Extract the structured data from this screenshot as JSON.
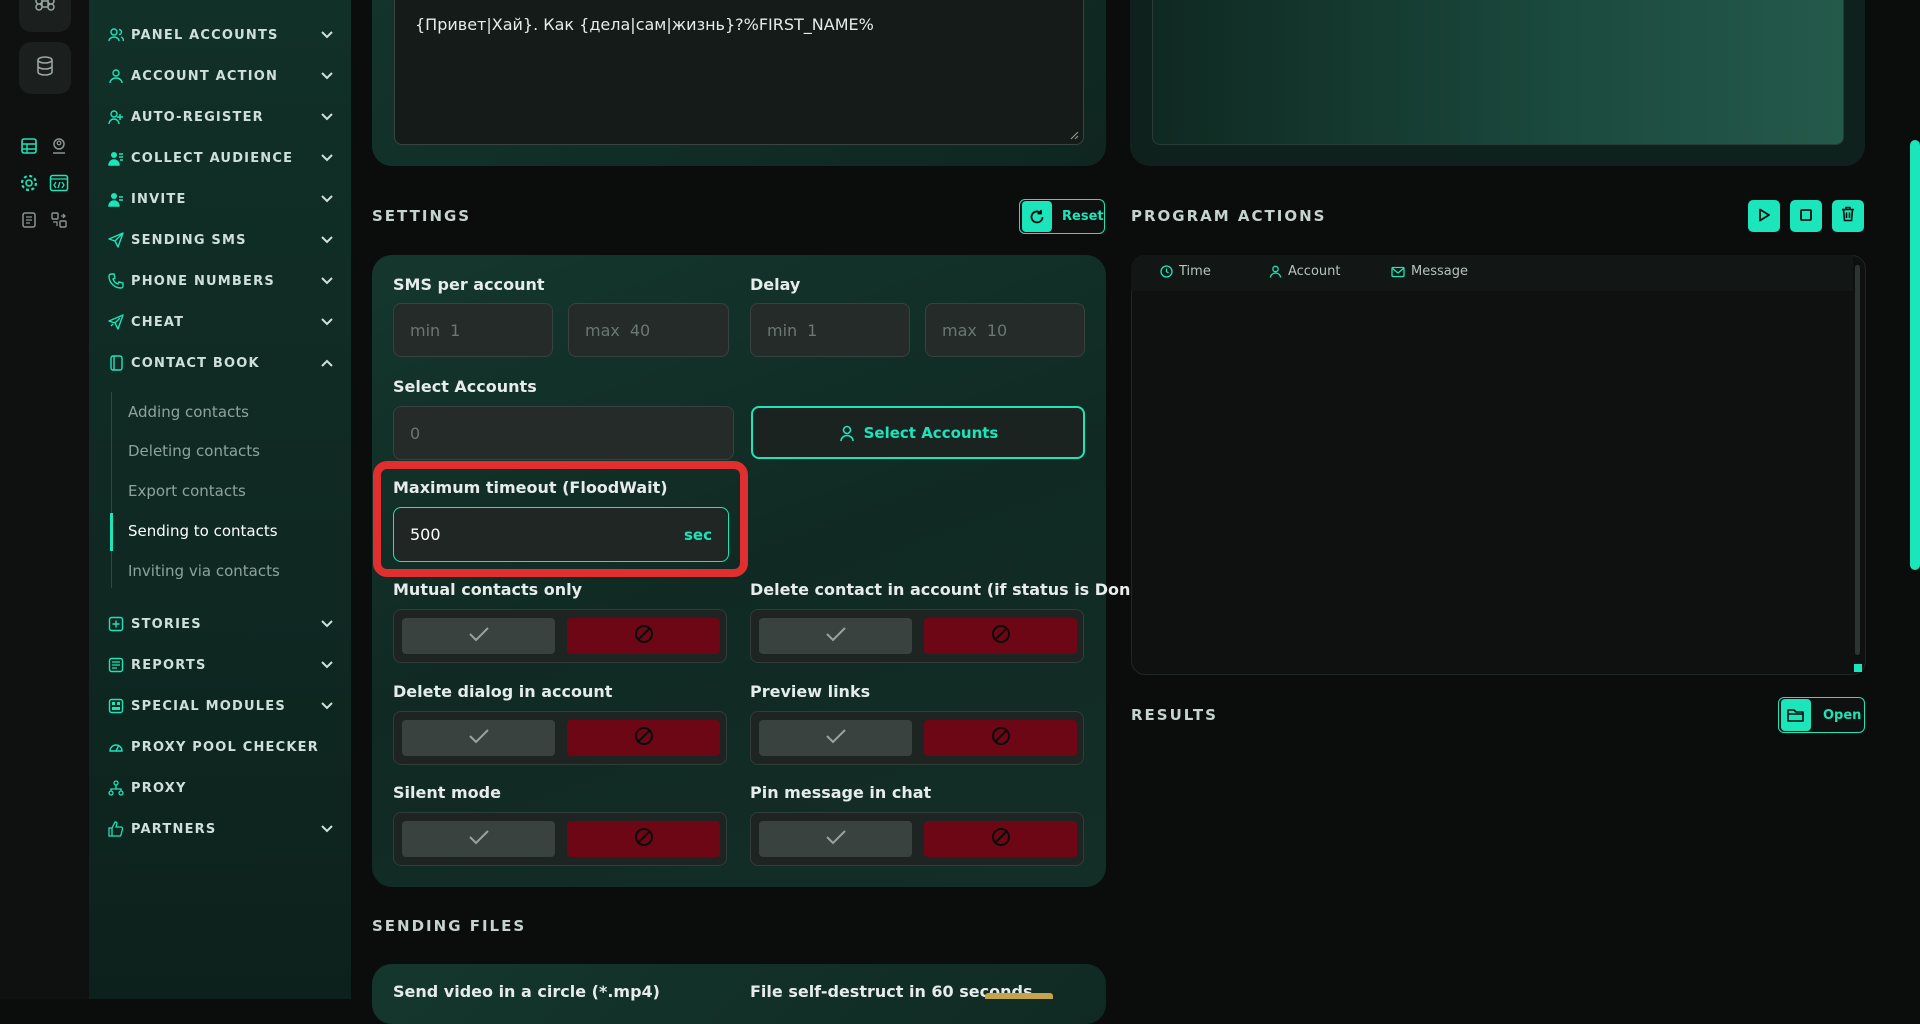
{
  "colors": {
    "accent": "#1be5bb",
    "danger_toggle": "#6d0716",
    "highlight": "#e12f2f",
    "sidebar_bg": "#113027"
  },
  "rail": {
    "icons": [
      "command-icon",
      "database-icon",
      "table-icon",
      "user-pin-icon",
      "settings-icon",
      "code-window-icon",
      "document-icon",
      "grid-icon"
    ]
  },
  "sidebar": {
    "items": [
      {
        "label": "PANEL ACCOUNTS",
        "icon": "users-icon",
        "chevron": "down"
      },
      {
        "label": "ACCOUNT ACTION",
        "icon": "user-icon",
        "chevron": "down"
      },
      {
        "label": "AUTO-REGISTER",
        "icon": "user-plus-icon",
        "chevron": "down"
      },
      {
        "label": "COLLECT AUDIENCE",
        "icon": "user-list-icon",
        "chevron": "down"
      },
      {
        "label": "INVITE",
        "icon": "user-invite-icon",
        "chevron": "down"
      },
      {
        "label": "SENDING SMS",
        "icon": "send-icon",
        "chevron": "down"
      },
      {
        "label": "PHONE NUMBERS",
        "icon": "phone-icon",
        "chevron": "down"
      },
      {
        "label": "CHEAT",
        "icon": "megaphone-icon",
        "chevron": "down"
      },
      {
        "label": "CONTACT BOOK",
        "icon": "book-icon",
        "chevron": "up"
      },
      {
        "label": "STORIES",
        "icon": "plus-square-icon",
        "chevron": "down"
      },
      {
        "label": "REPORTS",
        "icon": "report-icon",
        "chevron": "down"
      },
      {
        "label": "SPECIAL MODULES",
        "icon": "modules-icon",
        "chevron": "down"
      },
      {
        "label": "PROXY POOL CHECKER",
        "icon": "gauge-icon",
        "chevron": ""
      },
      {
        "label": "PROXY",
        "icon": "network-icon",
        "chevron": ""
      },
      {
        "label": "PARTNERS",
        "icon": "handshake-icon",
        "chevron": "down"
      }
    ],
    "contact_book_sub": [
      "Adding contacts",
      "Deleting contacts",
      "Export contacts",
      "Sending to contacts",
      "Inviting via contacts"
    ],
    "active_sub": "Sending to contacts"
  },
  "message": {
    "text": "{Привет|Хай}. Как {дела|сам|жизнь}?%FIRST_NAME%"
  },
  "settings": {
    "title": "SETTINGS",
    "reset_label": "Reset",
    "sms_per_account": {
      "label": "SMS per account",
      "min_prefix": "min",
      "min_placeholder": "1",
      "max_prefix": "max",
      "max_placeholder": "40"
    },
    "delay": {
      "label": "Delay",
      "min_prefix": "min",
      "min_placeholder": "1",
      "max_prefix": "max",
      "max_placeholder": "10"
    },
    "select_accounts": {
      "label": "Select Accounts",
      "count": "0",
      "button_label": "Select Accounts"
    },
    "timeout": {
      "label": "Maximum timeout (FloodWait)",
      "value": "500",
      "unit": "sec"
    },
    "toggles": [
      {
        "label": "Mutual contacts only"
      },
      {
        "label": "Delete contact in account (if status is Done)"
      },
      {
        "label": "Delete dialog in account"
      },
      {
        "label": "Preview links"
      },
      {
        "label": "Silent mode"
      },
      {
        "label": "Pin message in chat"
      }
    ]
  },
  "program_actions": {
    "title": "PROGRAM ACTIONS",
    "columns": [
      "Time",
      "Account",
      "Message"
    ]
  },
  "results": {
    "title": "RESULTS",
    "open_label": "Open"
  },
  "sending_files": {
    "title": "SENDING FILES",
    "video_label": "Send video in a circle (*.mp4)",
    "self_destruct_label": "File self-destruct in 60 seconds"
  }
}
